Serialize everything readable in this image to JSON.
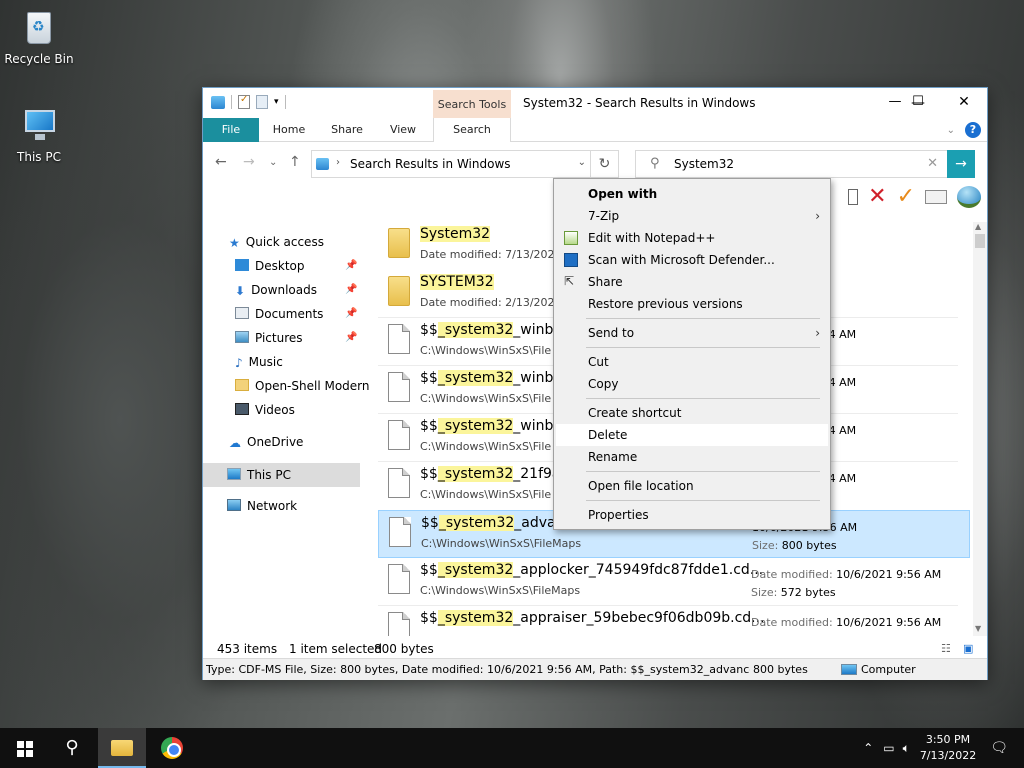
{
  "desktop": {
    "icons": [
      {
        "label": "Recycle Bin"
      },
      {
        "label": "This PC"
      }
    ]
  },
  "window": {
    "title": "System32 - Search Results in Windows",
    "contextual_tab": "Search Tools",
    "tabs": [
      "File",
      "Home",
      "Share",
      "View",
      "Search"
    ],
    "controls": {
      "minimize": "—",
      "maximize": "☐",
      "close": "✕"
    }
  },
  "address": {
    "path": "Search Results in Windows"
  },
  "search": {
    "value": "System32"
  },
  "nav_pane": {
    "items": [
      {
        "label": "Quick access",
        "icon": "star-icon"
      },
      {
        "label": "Desktop",
        "icon": "desktop-icon",
        "pinned": true
      },
      {
        "label": "Downloads",
        "icon": "download-icon",
        "pinned": true
      },
      {
        "label": "Documents",
        "icon": "documents-icon",
        "pinned": true
      },
      {
        "label": "Pictures",
        "icon": "pictures-icon",
        "pinned": true
      },
      {
        "label": "Music",
        "icon": "music-icon"
      },
      {
        "label": "Open-Shell Modern",
        "icon": "folder-icon"
      },
      {
        "label": "Videos",
        "icon": "videos-icon"
      },
      {
        "label": "OneDrive",
        "icon": "cloud-icon"
      },
      {
        "label": "This PC",
        "icon": "computer-icon",
        "selected": true
      },
      {
        "label": "Network",
        "icon": "network-icon"
      }
    ]
  },
  "results": [
    {
      "pre": "",
      "hl": "System32",
      "post": "",
      "sub": "Date modified: 7/13/2022",
      "type": "folder",
      "m1l": "",
      "m1v": "",
      "m2l": "",
      "m2v": ""
    },
    {
      "pre": "",
      "hl": "SYSTEM32",
      "post": "",
      "sub": "Date modified: 2/13/2022",
      "type": "folder",
      "m1l": "",
      "m1v": "",
      "m2l": "",
      "m2v": ""
    },
    {
      "pre": "$$",
      "hl": "_system32",
      "post": "_winbio",
      "sub": "C:\\Windows\\WinSxS\\File",
      "type": "file",
      "m1l": "",
      "m1v": "2/13/2022 1:24 AM",
      "m2l": "",
      "m2v": ""
    },
    {
      "pre": "$$",
      "hl": "_system32",
      "post": "_winbio",
      "sub": "C:\\Windows\\WinSxS\\File",
      "type": "file",
      "m1l": "",
      "m1v": "2/13/2022 1:24 AM",
      "m2l": "",
      "m2v": ""
    },
    {
      "pre": "$$",
      "hl": "_system32",
      "post": "_winbio",
      "sub": "C:\\Windows\\WinSxS\\File",
      "type": "file",
      "m1l": "",
      "m1v": "2/13/2022 1:24 AM",
      "m2l": "",
      "m2v": ""
    },
    {
      "pre": "$$",
      "hl": "_system32",
      "post": "_21f9a9",
      "sub": "C:\\Windows\\WinSxS\\File",
      "type": "file",
      "m1l": "",
      "m1v": "2/13/2022 1:24 AM",
      "m2l": "",
      "m2v": ""
    },
    {
      "pre": "$$",
      "hl": "_system32",
      "post": "_advanc",
      "sub": "C:\\Windows\\WinSxS\\FileMaps",
      "type": "file",
      "selected": true,
      "m1l": "",
      "m1v": "10/6/2021 9:56 AM",
      "m2l": "Size:",
      "m2v": "800 bytes"
    },
    {
      "pre": "$$",
      "hl": "_system32",
      "post": "_applocker_745949fdc87fdde1.cd...",
      "sub": "C:\\Windows\\WinSxS\\FileMaps",
      "type": "file",
      "m1l": "Date modified:",
      "m1v": "10/6/2021 9:56 AM",
      "m2l": "Size:",
      "m2v": "572 bytes"
    },
    {
      "pre": "$$",
      "hl": "_system32",
      "post": "_appraiser_59bebec9f06db09b.cd...",
      "sub": "",
      "type": "file",
      "m1l": "Date modified:",
      "m1v": "10/6/2021 9:56 AM",
      "m2l": "",
      "m2v": ""
    }
  ],
  "status": {
    "count": "453 items",
    "selected": "1 item selected",
    "size": "800 bytes"
  },
  "details_bar": {
    "info": "Type: CDF-MS File, Size: 800 bytes, Date modified: 10/6/2021 9:56 AM, Path: $$_system32_advancedinsta",
    "size": "800 bytes",
    "location": "Computer"
  },
  "context_menu": {
    "items": [
      {
        "label": "Open with",
        "bold": true
      },
      {
        "label": "7-Zip",
        "submenu": true
      },
      {
        "label": "Edit with Notepad++",
        "icon": "notepadpp-icon"
      },
      {
        "label": "Scan with Microsoft Defender...",
        "icon": "defender-icon"
      },
      {
        "label": "Share",
        "icon": "share-icon"
      },
      {
        "label": "Restore previous versions"
      },
      {
        "label": "Send to",
        "submenu": true
      },
      {
        "label": "Cut"
      },
      {
        "label": "Copy"
      },
      {
        "label": "Create shortcut"
      },
      {
        "label": "Delete",
        "highlighted": true
      },
      {
        "label": "Rename"
      },
      {
        "label": "Open file location"
      },
      {
        "label": "Properties"
      }
    ]
  },
  "taskbar": {
    "time": "3:50 PM",
    "date": "7/13/2022"
  },
  "colors": {
    "accent": "#1b8f9e",
    "selection": "#cce8ff",
    "highlight": "#fbf59b"
  }
}
